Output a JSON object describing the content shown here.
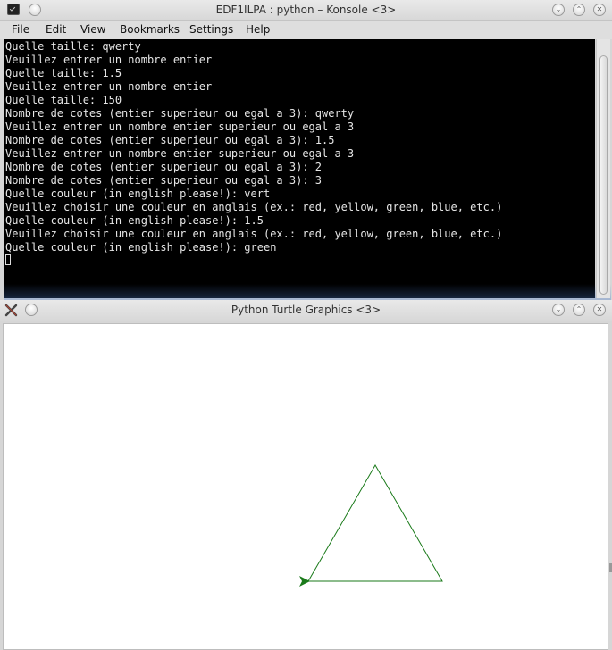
{
  "konsole": {
    "title": "EDF1ILPA : python – Konsole <3>",
    "menu": [
      "File",
      "Edit",
      "View",
      "Bookmarks",
      "Settings",
      "Help"
    ],
    "lines": [
      "Quelle taille: qwerty",
      "Veuillez entrer un nombre entier",
      "Quelle taille: 1.5",
      "Veuillez entrer un nombre entier",
      "Quelle taille: 150",
      "Nombre de cotes (entier superieur ou egal a 3): qwerty",
      "Veuillez entrer un nombre entier superieur ou egal a 3",
      "Nombre de cotes (entier superieur ou egal a 3): 1.5",
      "Veuillez entrer un nombre entier superieur ou egal a 3",
      "Nombre de cotes (entier superieur ou egal a 3): 2",
      "Nombre de cotes (entier superieur ou egal a 3): 3",
      "Quelle couleur (in english please!): vert",
      "Veuillez choisir une couleur en anglais (ex.: red, yellow, green, blue, etc.)",
      "Quelle couleur (in english please!): 1.5",
      "Veuillez choisir une couleur en anglais (ex.: red, yellow, green, blue, etc.)",
      "Quelle couleur (in english please!): green"
    ]
  },
  "turtle_window": {
    "title": "Python Turtle Graphics <3>"
  },
  "drawing": {
    "shape": "triangle",
    "pen_color": "#1a7a1a",
    "turtle_color": "#1a7a1a"
  },
  "colors": {
    "terminal_bg": "#000000",
    "terminal_fg": "#e6e6e6",
    "canvas_bg": "#ffffff"
  }
}
